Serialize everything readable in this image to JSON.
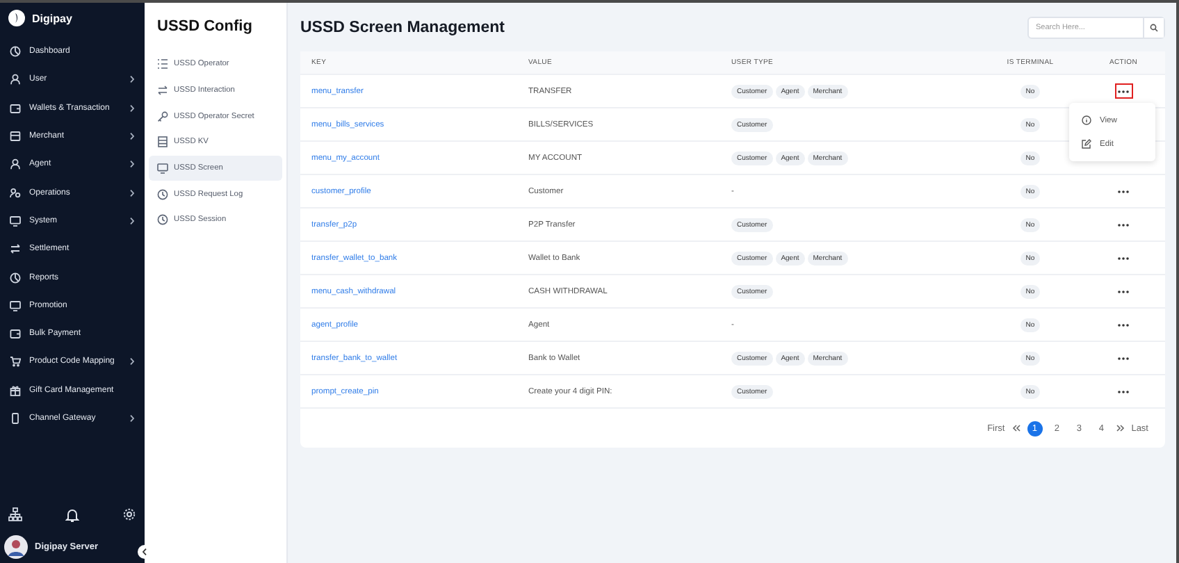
{
  "brand": "Digipay",
  "sidebar": {
    "items": [
      {
        "label": "Dashboard",
        "has_submenu": false
      },
      {
        "label": "User",
        "has_submenu": true
      },
      {
        "label": "Wallets & Transaction",
        "has_submenu": true
      },
      {
        "label": "Merchant",
        "has_submenu": true
      },
      {
        "label": "Agent",
        "has_submenu": true
      },
      {
        "label": "Operations",
        "has_submenu": true
      },
      {
        "label": "System",
        "has_submenu": true
      },
      {
        "label": "Settlement",
        "has_submenu": false
      },
      {
        "label": "Reports",
        "has_submenu": false
      },
      {
        "label": "Promotion",
        "has_submenu": false
      },
      {
        "label": "Bulk Payment",
        "has_submenu": false
      },
      {
        "label": "Product Code Mapping",
        "has_submenu": true
      },
      {
        "label": "Gift Card Management",
        "has_submenu": false
      },
      {
        "label": "Channel Gateway",
        "has_submenu": true
      }
    ],
    "user": "Digipay Server"
  },
  "submenu": {
    "title": "USSD Config",
    "items": [
      {
        "label": "USSD Operator",
        "selected": false
      },
      {
        "label": "USSD Interaction",
        "selected": false
      },
      {
        "label": "USSD Operator Secret",
        "selected": false
      },
      {
        "label": "USSD KV",
        "selected": false
      },
      {
        "label": "USSD Screen",
        "selected": true
      },
      {
        "label": "USSD Request Log",
        "selected": false
      },
      {
        "label": "USSD Session",
        "selected": false
      }
    ]
  },
  "page_title": "USSD Screen Management",
  "search": {
    "placeholder": "Search Here..."
  },
  "table": {
    "columns": [
      "KEY",
      "VALUE",
      "USER TYPE",
      "IS TERMINAL",
      "ACTION"
    ],
    "rows": [
      {
        "key": "menu_transfer",
        "value": "TRANSFER",
        "user_types": [
          "Customer",
          "Agent",
          "Merchant"
        ],
        "is_terminal": "No",
        "menu_open": true
      },
      {
        "key": "menu_bills_services",
        "value": "BILLS/SERVICES",
        "user_types": [
          "Customer"
        ],
        "is_terminal": "No",
        "menu_open": false
      },
      {
        "key": "menu_my_account",
        "value": "MY ACCOUNT",
        "user_types": [
          "Customer",
          "Agent",
          "Merchant"
        ],
        "is_terminal": "No",
        "menu_open": false
      },
      {
        "key": "customer_profile",
        "value": "Customer",
        "user_types": [],
        "no_type": "-",
        "is_terminal": "No",
        "menu_open": false
      },
      {
        "key": "transfer_p2p",
        "value": "P2P Transfer",
        "user_types": [
          "Customer"
        ],
        "is_terminal": "No",
        "menu_open": false
      },
      {
        "key": "transfer_wallet_to_bank",
        "value": "Wallet to Bank",
        "user_types": [
          "Customer",
          "Agent",
          "Merchant"
        ],
        "is_terminal": "No",
        "menu_open": false
      },
      {
        "key": "menu_cash_withdrawal",
        "value": "CASH WITHDRAWAL",
        "user_types": [
          "Customer"
        ],
        "is_terminal": "No",
        "menu_open": false
      },
      {
        "key": "agent_profile",
        "value": "Agent",
        "user_types": [],
        "no_type": "-",
        "is_terminal": "No",
        "menu_open": false
      },
      {
        "key": "transfer_bank_to_wallet",
        "value": "Bank to Wallet",
        "user_types": [
          "Customer",
          "Agent",
          "Merchant"
        ],
        "is_terminal": "No",
        "menu_open": false
      },
      {
        "key": "prompt_create_pin",
        "value": "Create your 4 digit PIN:",
        "user_types": [
          "Customer"
        ],
        "is_terminal": "No",
        "menu_open": false
      }
    ],
    "action_menu": [
      "View",
      "Edit"
    ]
  },
  "pagination": {
    "first": "First",
    "last": "Last",
    "pages": [
      {
        "label": "1",
        "selected": true
      },
      {
        "label": "2",
        "selected": false
      },
      {
        "label": "3",
        "selected": false
      },
      {
        "label": "4",
        "selected": false
      }
    ]
  }
}
